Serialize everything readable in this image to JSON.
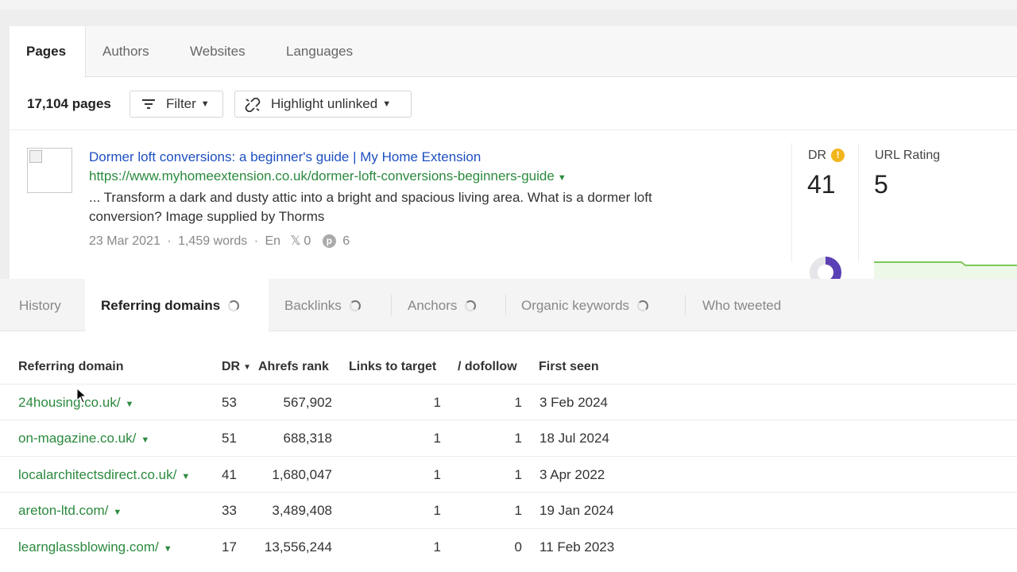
{
  "top_tabs": [
    {
      "label": "Pages",
      "active": true
    },
    {
      "label": "Authors",
      "active": false
    },
    {
      "label": "Websites",
      "active": false
    },
    {
      "label": "Languages",
      "active": false
    }
  ],
  "toolbar": {
    "page_count": "17,104 pages",
    "filter_label": "Filter",
    "highlight_label": "Highlight unlinked"
  },
  "result": {
    "title": "Dormer loft conversions: a beginner's guide | My Home Extension",
    "url": "https://www.myhomeextension.co.uk/dormer-loft-conversions-beginners-guide",
    "snippet": "... Transform a dark and dusty attic into a bright and spacious living area.  What is a dormer loft conversion? Image supplied by Thorms",
    "date": "23 Mar 2021",
    "words": "1,459 words",
    "lang": "En",
    "x_count": "0",
    "pinterest_count": "6",
    "dr_label": "DR",
    "dr_value": "41",
    "url_rating_label": "URL Rating",
    "url_rating_value": "5"
  },
  "bottom_tabs": [
    {
      "label": "History",
      "active": false,
      "spinner": false
    },
    {
      "label": "Referring domains",
      "active": true,
      "spinner": true
    },
    {
      "label": "Backlinks",
      "active": false,
      "spinner": true
    },
    {
      "label": "Anchors",
      "active": false,
      "spinner": true
    },
    {
      "label": "Organic keywords",
      "active": false,
      "spinner": true
    },
    {
      "label": "Who tweeted",
      "active": false,
      "spinner": false
    }
  ],
  "table": {
    "headers": {
      "domain": "Referring domain",
      "dr": "DR",
      "rank": "Ahrefs rank",
      "links": "Links to target",
      "dofollow": "/ dofollow",
      "first_seen": "First seen"
    },
    "rows": [
      {
        "domain": "24housing.co.uk/",
        "dr": "53",
        "rank": "567,902",
        "links": "1",
        "dofollow": "1",
        "first_seen": "3 Feb 2024"
      },
      {
        "domain": "on-magazine.co.uk/",
        "dr": "51",
        "rank": "688,318",
        "links": "1",
        "dofollow": "1",
        "first_seen": "18 Jul 2024"
      },
      {
        "domain": "localarchitectsdirect.co.uk/",
        "dr": "41",
        "rank": "1,680,047",
        "links": "1",
        "dofollow": "1",
        "first_seen": "3 Apr 2022"
      },
      {
        "domain": "areton-ltd.com/",
        "dr": "33",
        "rank": "3,489,408",
        "links": "1",
        "dofollow": "1",
        "first_seen": "19 Jan 2024"
      },
      {
        "domain": "learnglassblowing.com/",
        "dr": "17",
        "rank": "13,556,244",
        "links": "1",
        "dofollow": "0",
        "first_seen": "11 Feb 2023"
      }
    ]
  },
  "colors": {
    "link_blue": "#1e4fc0",
    "link_green": "#2b8a3e",
    "dr_ring": "#5b3fb5",
    "info_yellow": "#f2b51c",
    "rating_line": "#7ec85a"
  }
}
